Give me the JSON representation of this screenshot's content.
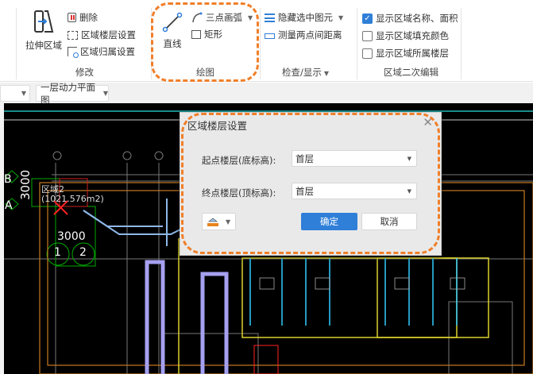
{
  "ribbon": {
    "groups": {
      "modify": {
        "label": "修改",
        "stretch": "拉伸区域",
        "delete": "删除",
        "floor_setting": "区域楼层设置",
        "owner_setting": "区域归属设置"
      },
      "draw": {
        "label": "绘图",
        "line": "直线",
        "arc": "三点画弧",
        "rect": "矩形"
      },
      "check": {
        "label": "检查/显示",
        "hide": "隐藏选中图元",
        "measure": "测量两点间距离"
      },
      "region_edit": {
        "label": "区域二次编辑",
        "checkboxes": [
          {
            "label": "显示区域名称、面积",
            "checked": true
          },
          {
            "label": "显示区域填充颜色",
            "checked": false
          },
          {
            "label": "显示区域所属楼层",
            "checked": false
          }
        ]
      }
    }
  },
  "toolbar": {
    "first_dropdown": "",
    "drawing_select": "一层动力平面图"
  },
  "canvas": {
    "region_name": "区域2",
    "region_area": "(1021.576m2)",
    "dim1": "3000",
    "dim2": "3000",
    "axis_b": "B",
    "axis_a": "A",
    "axis_1": "1",
    "axis_2": "2"
  },
  "dialog": {
    "title": "区域楼层设置",
    "start_label": "起点楼层(底标高):",
    "start_value": "首层",
    "end_label": "终点楼层(顶标高):",
    "end_value": "首层",
    "ok": "确定",
    "cancel": "取消"
  },
  "colors": {
    "accent": "#2f7fd8",
    "highlight": "#f07f2a",
    "canvas_bg": "#000000"
  }
}
